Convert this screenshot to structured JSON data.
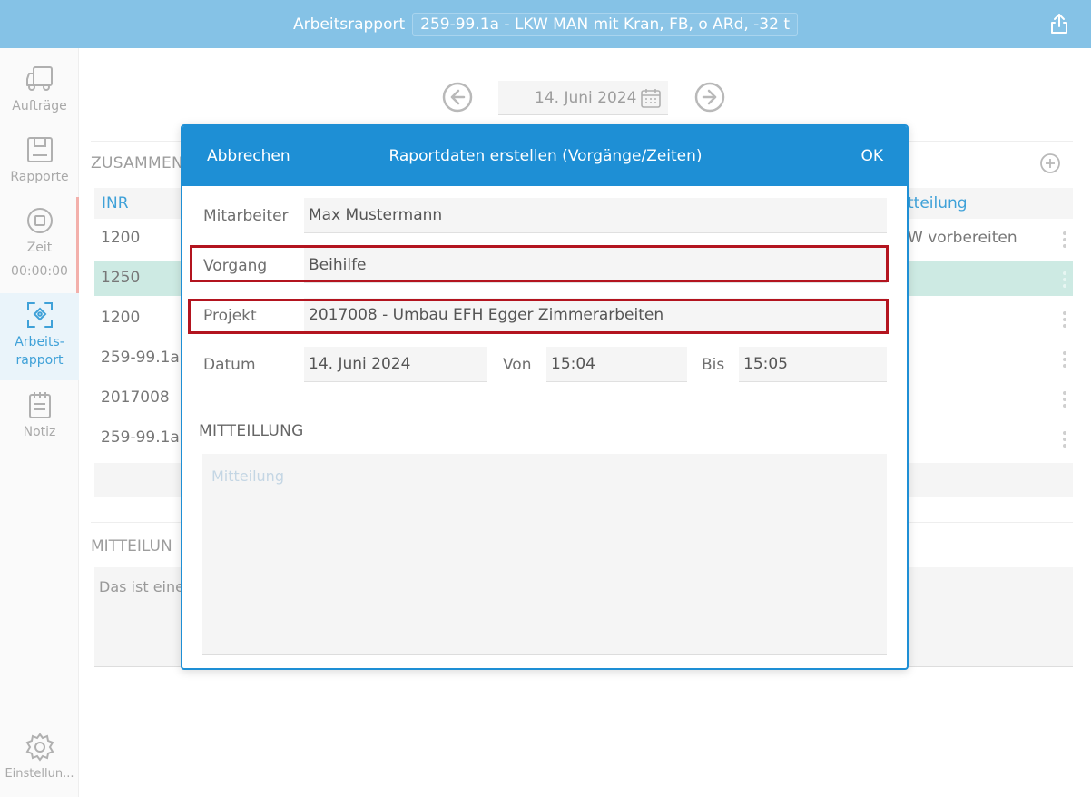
{
  "topbar": {
    "title": "Arbeitsrapport",
    "subtitle": "259-99.1a - LKW MAN mit Kran, FB, o ARd, -32 t",
    "share_icon": "share-icon"
  },
  "sidebar": {
    "items": [
      {
        "label": "Aufträge",
        "icon": "truck-icon"
      },
      {
        "label": "Rapporte",
        "icon": "report-icon"
      },
      {
        "label": "Zeit",
        "icon": "stop-icon",
        "value": "00:00:00"
      },
      {
        "label": "Arbeits-",
        "label2": "rapport",
        "icon": "scan-icon"
      },
      {
        "label": "Notiz",
        "icon": "notepad-icon"
      },
      {
        "label": "Einstellun...",
        "icon": "gear-icon"
      }
    ]
  },
  "background": {
    "date": "14. Juni 2024",
    "section_title": "ZUSAMMEN",
    "columns": {
      "inr": "INR",
      "mitteilung": "tteilung"
    },
    "rows": [
      {
        "inr": "1200",
        "mit": "W vorbereiten"
      },
      {
        "inr": "1250",
        "mit": ""
      },
      {
        "inr": "1200",
        "mit": ""
      },
      {
        "inr": "259-99.1a",
        "mit": ""
      },
      {
        "inr": "2017008",
        "mit": ""
      },
      {
        "inr": "259-99.1a",
        "mit": ""
      }
    ],
    "mit_title": "MITTEILUN",
    "mit_text": "Das ist eine"
  },
  "modal": {
    "cancel": "Abbrechen",
    "title": "Raportdaten erstellen (Vorgänge/Zeiten)",
    "ok": "OK",
    "fields": {
      "mitarbeiter_label": "Mitarbeiter",
      "mitarbeiter_value": "Max Mustermann",
      "vorgang_label": "Vorgang",
      "vorgang_value": "Beihilfe",
      "projekt_label": "Projekt",
      "projekt_value": "2017008 - Umbau EFH Egger Zimmerarbeiten",
      "datum_label": "Datum",
      "datum_value": "14. Juni 2024",
      "von_label": "Von",
      "von_value": "15:04",
      "bis_label": "Bis",
      "bis_value": "15:05"
    },
    "mitteilung_title": "MITTEILLUNG",
    "mitteilung_placeholder": "Mitteilung"
  },
  "colors": {
    "topbar": "#85c2e6",
    "modal_header": "#1e8fd5",
    "accent": "#3fa1d8",
    "highlight_row": "#cdeae3",
    "annotation_red": "#b3141f"
  }
}
